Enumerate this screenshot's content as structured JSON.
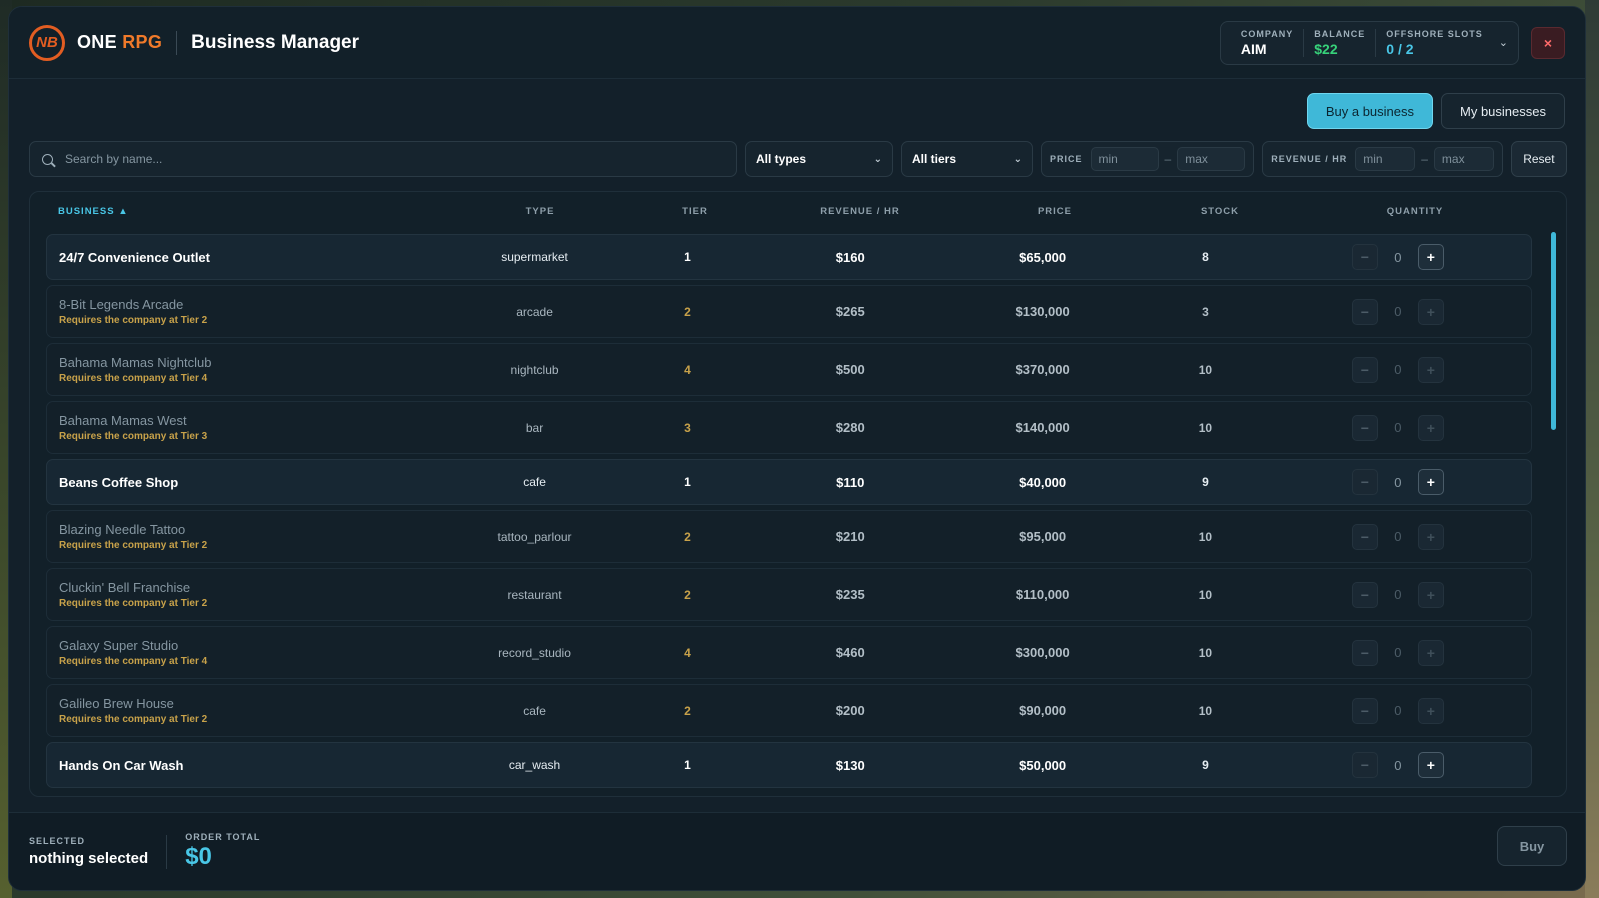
{
  "header": {
    "logo_text": "NB",
    "brand_one": "ONE",
    "brand_rpg": "RPG",
    "title": "Business Manager",
    "company_label": "COMPANY",
    "company_value": "AIM",
    "balance_label": "BALANCE",
    "balance_value": "$22",
    "offshore_label": "OFFSHORE SLOTS",
    "offshore_value": "0 / 2",
    "close_symbol": "×"
  },
  "tabs": {
    "buy": "Buy a business",
    "mine": "My businesses"
  },
  "filters": {
    "search_placeholder": "Search by name...",
    "types_value": "All types",
    "tiers_value": "All tiers",
    "price_label": "PRICE",
    "price_min": "min",
    "price_max": "max",
    "revenue_label": "REVENUE / HR",
    "revenue_min": "min",
    "revenue_max": "max",
    "range_dash": "–",
    "reset": "Reset"
  },
  "table": {
    "headers": {
      "business": "BUSINESS ▲",
      "type": "TYPE",
      "tier": "TIER",
      "revenue": "REVENUE / HR",
      "price": "PRICE",
      "stock": "STOCK",
      "quantity": "QUANTITY"
    },
    "rows": [
      {
        "name": "24/7 Convenience Outlet",
        "requirement": "",
        "type": "supermarket",
        "tier": "1",
        "revenue": "$160",
        "price": "$65,000",
        "stock": "8",
        "qty": "0",
        "locked": false
      },
      {
        "name": "8-Bit Legends Arcade",
        "requirement": "Requires the company at Tier 2",
        "type": "arcade",
        "tier": "2",
        "revenue": "$265",
        "price": "$130,000",
        "stock": "3",
        "qty": "0",
        "locked": true
      },
      {
        "name": "Bahama Mamas Nightclub",
        "requirement": "Requires the company at Tier 4",
        "type": "nightclub",
        "tier": "4",
        "revenue": "$500",
        "price": "$370,000",
        "stock": "10",
        "qty": "0",
        "locked": true
      },
      {
        "name": "Bahama Mamas West",
        "requirement": "Requires the company at Tier 3",
        "type": "bar",
        "tier": "3",
        "revenue": "$280",
        "price": "$140,000",
        "stock": "10",
        "qty": "0",
        "locked": true
      },
      {
        "name": "Beans Coffee Shop",
        "requirement": "",
        "type": "cafe",
        "tier": "1",
        "revenue": "$110",
        "price": "$40,000",
        "stock": "9",
        "qty": "0",
        "locked": false
      },
      {
        "name": "Blazing Needle Tattoo",
        "requirement": "Requires the company at Tier 2",
        "type": "tattoo_parlour",
        "tier": "2",
        "revenue": "$210",
        "price": "$95,000",
        "stock": "10",
        "qty": "0",
        "locked": true
      },
      {
        "name": "Cluckin' Bell Franchise",
        "requirement": "Requires the company at Tier 2",
        "type": "restaurant",
        "tier": "2",
        "revenue": "$235",
        "price": "$110,000",
        "stock": "10",
        "qty": "0",
        "locked": true
      },
      {
        "name": "Galaxy Super Studio",
        "requirement": "Requires the company at Tier 4",
        "type": "record_studio",
        "tier": "4",
        "revenue": "$460",
        "price": "$300,000",
        "stock": "10",
        "qty": "0",
        "locked": true
      },
      {
        "name": "Galileo Brew House",
        "requirement": "Requires the company at Tier 2",
        "type": "cafe",
        "tier": "2",
        "revenue": "$200",
        "price": "$90,000",
        "stock": "10",
        "qty": "0",
        "locked": true
      },
      {
        "name": "Hands On Car Wash",
        "requirement": "",
        "type": "car_wash",
        "tier": "1",
        "revenue": "$130",
        "price": "$50,000",
        "stock": "9",
        "qty": "0",
        "locked": false
      }
    ]
  },
  "footer": {
    "selected_label": "SELECTED",
    "selected_value": "nothing selected",
    "total_label": "ORDER TOTAL",
    "total_value": "$0",
    "buy": "Buy"
  },
  "colors": {
    "accent": "#49c6e6",
    "balance": "#37d27a",
    "brand": "#f07a2a",
    "tier_locked": "#c8a24a"
  }
}
